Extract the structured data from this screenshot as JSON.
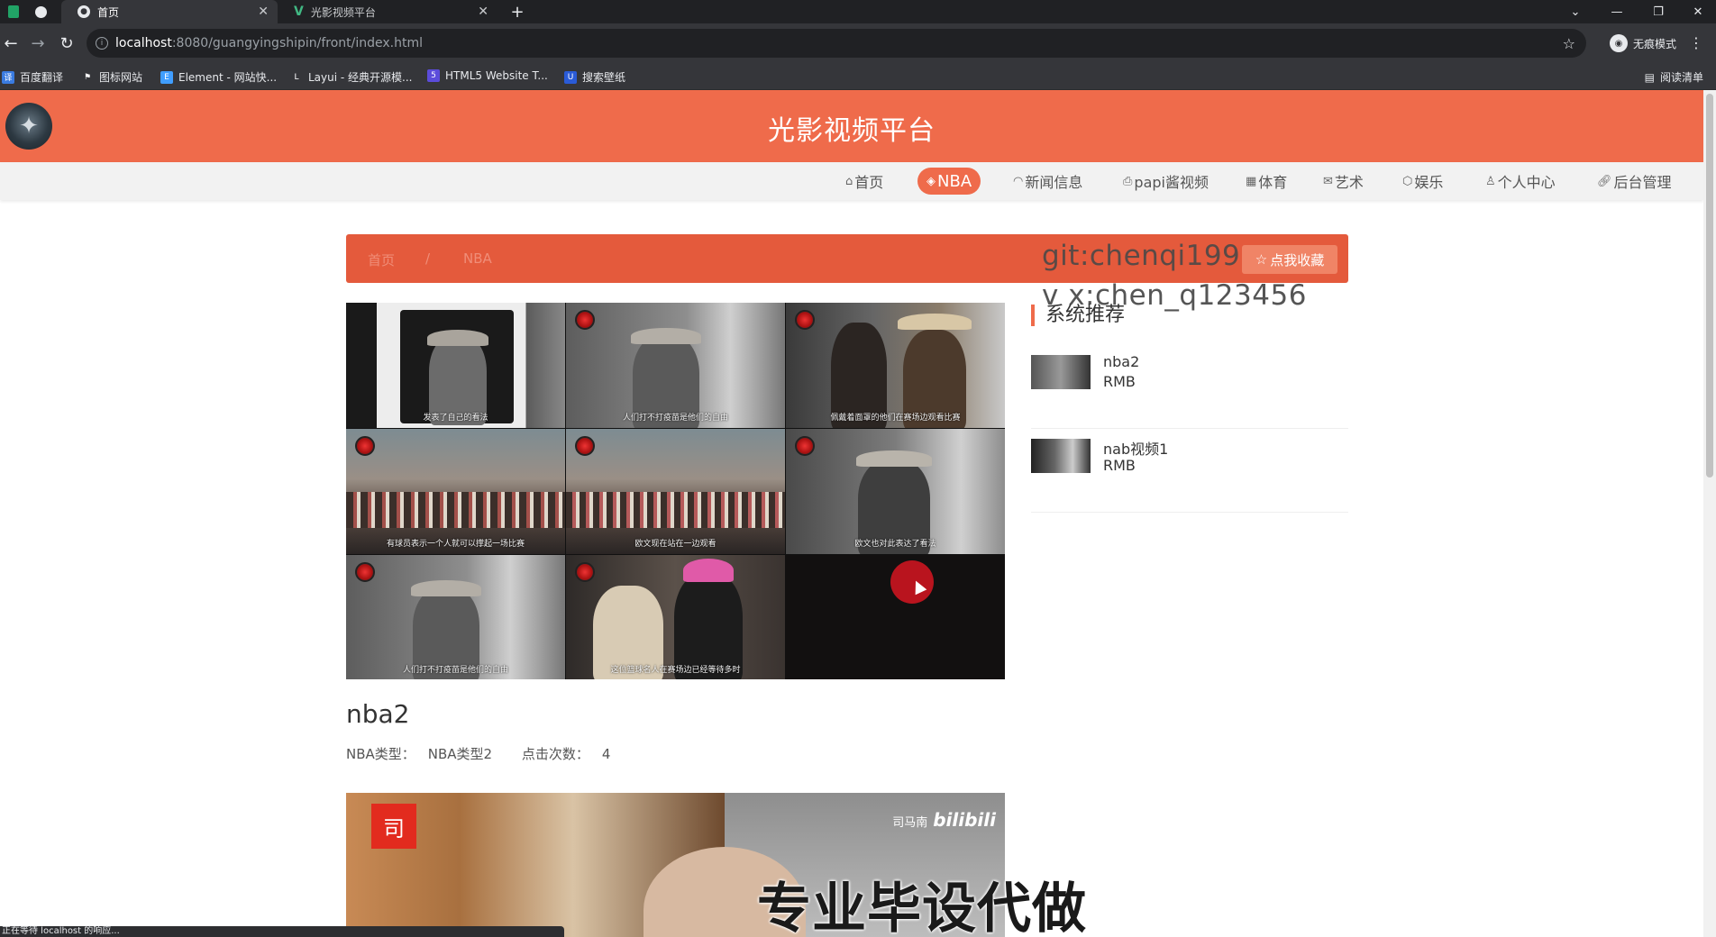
{
  "browser": {
    "tabs": [
      {
        "title": "首页",
        "active": true
      },
      {
        "title": "光影视频平台",
        "active": false
      }
    ],
    "url": {
      "host": "localhost",
      "path": ":8080/guangyingshipin/front/index.html"
    },
    "incognito_label": "无痕模式",
    "bookmarks": [
      "百度翻译",
      "图标网站",
      "Element - 网站快...",
      "Layui - 经典开源模...",
      "HTML5 Website T...",
      "搜索壁纸"
    ],
    "reading_list": "阅读清单",
    "status_text": "正在等待 localhost 的响应..."
  },
  "site": {
    "title": "光影视频平台",
    "nav": [
      "首页",
      "NBA",
      "新闻信息",
      "papi酱视频",
      "体育",
      "艺术",
      "娱乐",
      "个人中心",
      "后台管理"
    ],
    "active_nav": "NBA"
  },
  "breadcrumb": {
    "home": "首页",
    "sep": "/",
    "current": "NBA"
  },
  "watermark": {
    "line1": "git:chenqi199",
    "line2": "v x:chen_q123456"
  },
  "favorite_button": "点我收藏",
  "video": {
    "title": "nba2",
    "type_label": "NBA类型：",
    "type_value": "NBA类型2",
    "clicks_label": "点击次数：",
    "clicks_value": "4",
    "captions": [
      "发表了自己的看法",
      "人们打不打疫苗是他们的自由",
      "佩戴着面罩的他们在赛场边观看比赛",
      "有球员表示一个人就可以撑起一场比赛",
      "欧文现在站在一边观看",
      "欧文也对此表达了看法",
      "人们打不打疫苗是他们的自由",
      "这位篮球名人在赛场边已经等待多时"
    ]
  },
  "video2": {
    "brand": "司马南",
    "brand_logo": "bilibili",
    "logo_char": "司"
  },
  "promo_text": "专业毕设代做",
  "recommend": {
    "title": "系统推荐",
    "items": [
      {
        "name": "nba2",
        "price": "RMB"
      },
      {
        "name": "nab视频1",
        "price": "RMB"
      }
    ]
  },
  "icons": {
    "nav": "outline-icons",
    "favorite": "star-icon"
  },
  "colors": {
    "header": "#ef6b4b",
    "crumbbar": "#e45a3c",
    "nav_bg": "#f2f2f2"
  }
}
